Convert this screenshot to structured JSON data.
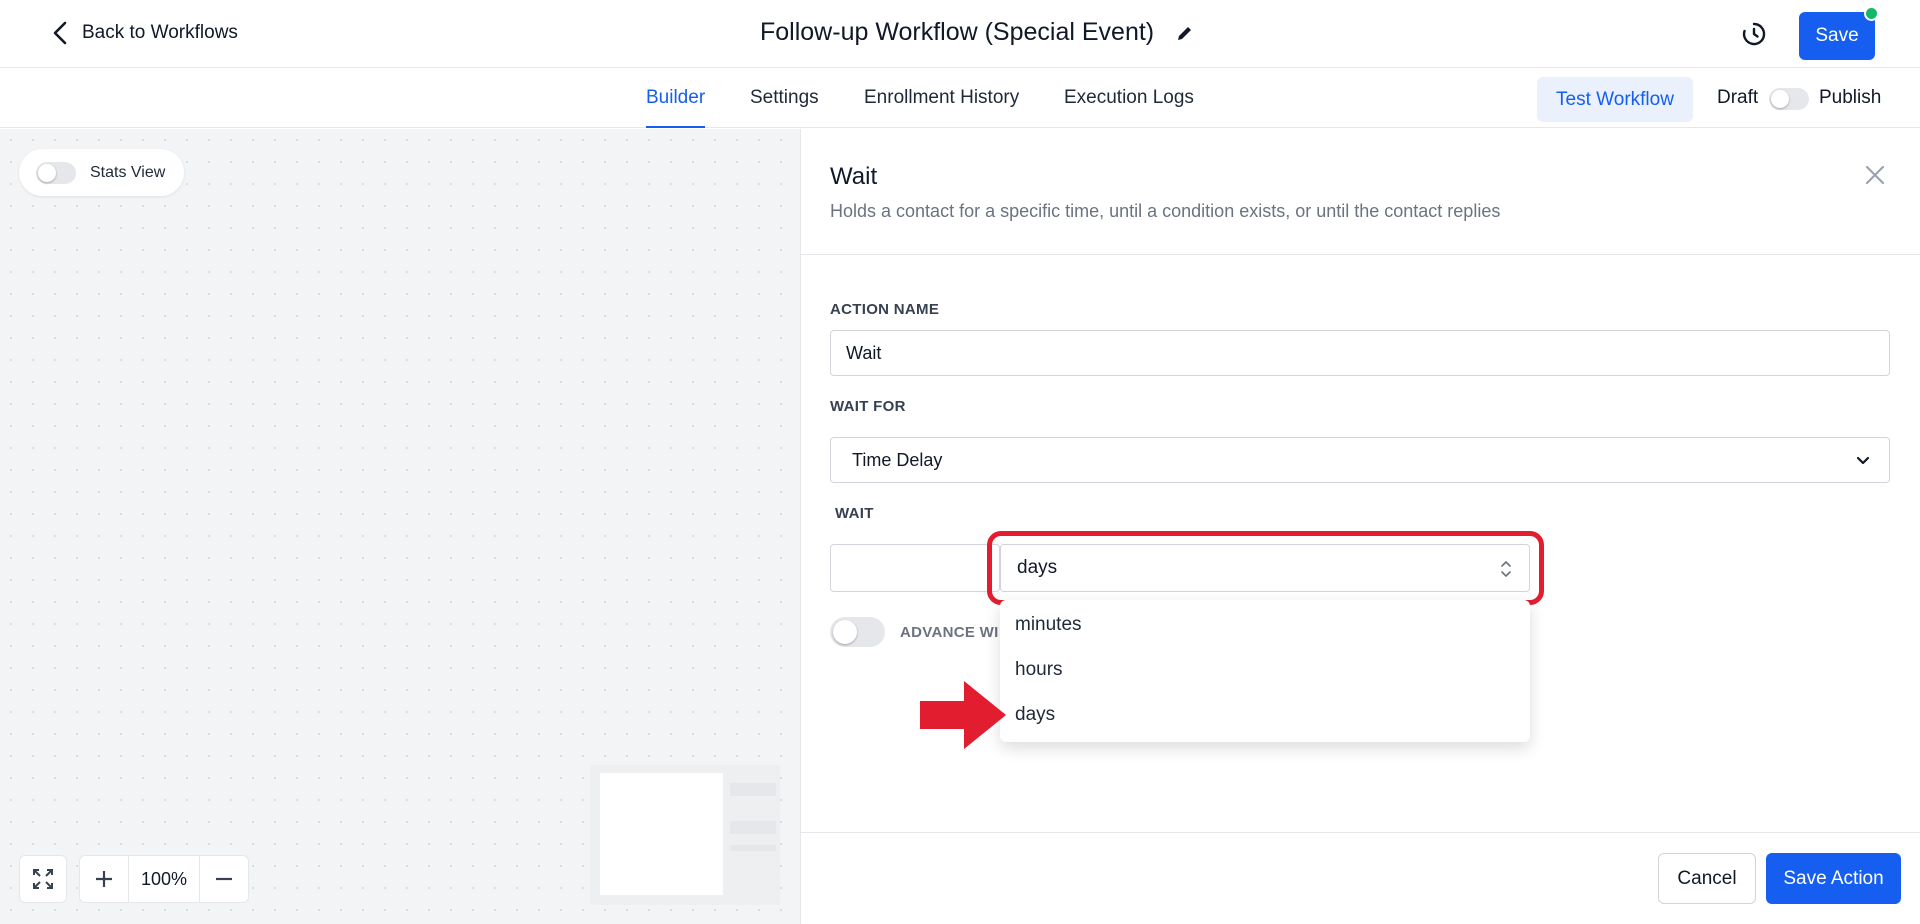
{
  "header": {
    "back_label": "Back to Workflows",
    "workflow_title": "Follow-up Workflow (Special Event)",
    "save_label": "Save"
  },
  "tabs": [
    {
      "label": "Builder",
      "active": true
    },
    {
      "label": "Settings",
      "active": false
    },
    {
      "label": "Enrollment History",
      "active": false
    },
    {
      "label": "Execution Logs",
      "active": false
    }
  ],
  "toolbar": {
    "test_label": "Test Workflow",
    "draft_label": "Draft",
    "publish_label": "Publish",
    "published": false
  },
  "canvas": {
    "stats_label": "Stats View",
    "stats_on": false,
    "zoom_level": "100%"
  },
  "panel": {
    "title": "Wait",
    "subtitle": "Holds a contact for a specific time, until a condition exists, or until the contact replies",
    "action_name_label": "ACTION NAME",
    "action_name_value": "Wait",
    "wait_for_label": "WAIT FOR",
    "wait_for_value": "Time Delay",
    "wait_label": "WAIT",
    "wait_amount_value": "",
    "wait_unit_value": "days",
    "advance_label": "ADVANCE WI",
    "unit_options": [
      "minutes",
      "hours",
      "days"
    ],
    "cancel_label": "Cancel",
    "save_action_label": "Save Action"
  },
  "colors": {
    "primary": "#155eef",
    "highlight": "#e11d2f",
    "status_dot": "#12b76a"
  }
}
